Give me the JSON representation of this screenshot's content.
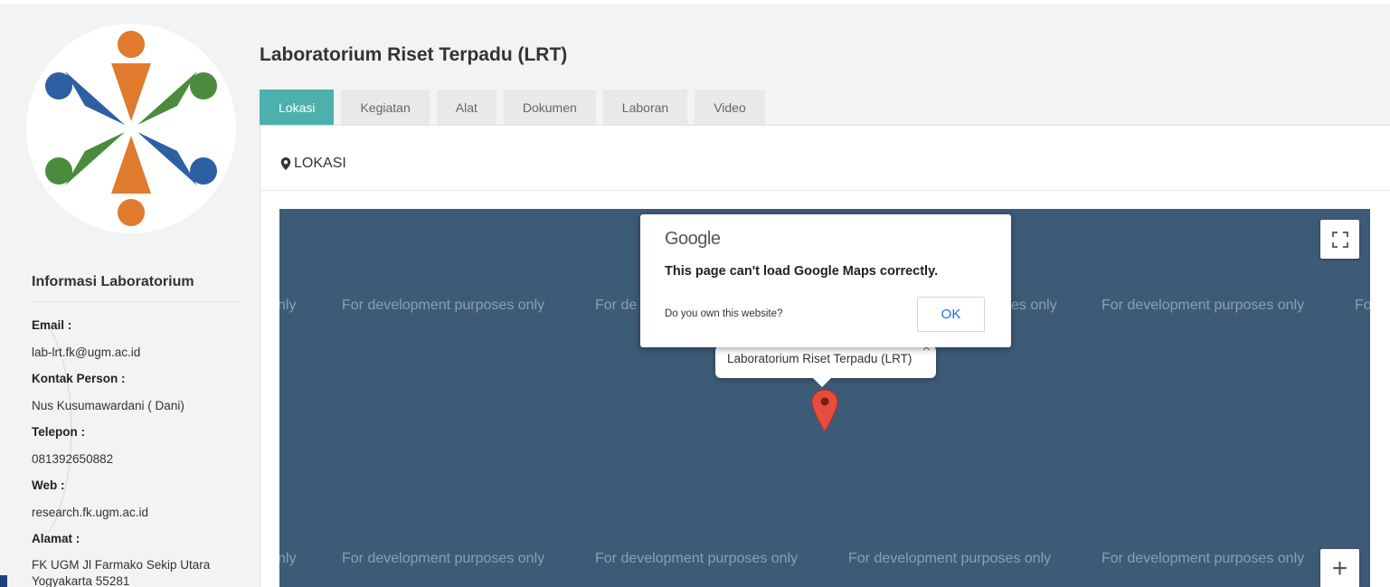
{
  "sidebar": {
    "info_title": "Informasi Laboratorium",
    "email_label": "Email :",
    "email_value": "lab-lrt.fk@ugm.ac.id",
    "contact_label": "Kontak Person :",
    "contact_value": "Nus Kusumawardani ( Dani)",
    "phone_label": "Telepon :",
    "phone_value": "081392650882",
    "web_label": "Web :",
    "web_value": "research.fk.ugm.ac.id",
    "address_label": "Alamat :",
    "address_line1": "FK UGM Jl Farmako Sekip Utara",
    "address_line2": "Yogyakarta 55281"
  },
  "main": {
    "title": "Laboratorium Riset Terpadu (LRT)",
    "tabs": [
      {
        "label": "Lokasi"
      },
      {
        "label": "Kegiatan"
      },
      {
        "label": "Alat"
      },
      {
        "label": "Dokumen"
      },
      {
        "label": "Laboran"
      },
      {
        "label": "Video"
      }
    ],
    "active_tab": "Lokasi",
    "panel_title": "LOKASI"
  },
  "map": {
    "watermark_text": "For development purposes only",
    "watermark_short": "nly",
    "watermark_fragment_1": "For de",
    "watermark_fragment_2": "es only",
    "watermark_fragment_3": "Fo",
    "zoom_in_label": "+",
    "info_window_text": "Laboratorium Riset Terpadu (LRT)",
    "info_window_close": "×",
    "dialog": {
      "brand": "Google",
      "message": "This page can't load Google Maps correctly.",
      "question": "Do you own this website?",
      "ok_label": "OK"
    }
  },
  "colors": {
    "accent_teal": "#4db0ad",
    "map_background": "#3d5a76",
    "marker_red": "#e74c3c",
    "logo_orange": "#e07a2d",
    "logo_blue": "#2d5fa3",
    "logo_green": "#4a8c3c"
  },
  "icons": {
    "panel": "map-marker-icon",
    "fullscreen": "fullscreen-icon",
    "marker": "map-pin-icon"
  }
}
